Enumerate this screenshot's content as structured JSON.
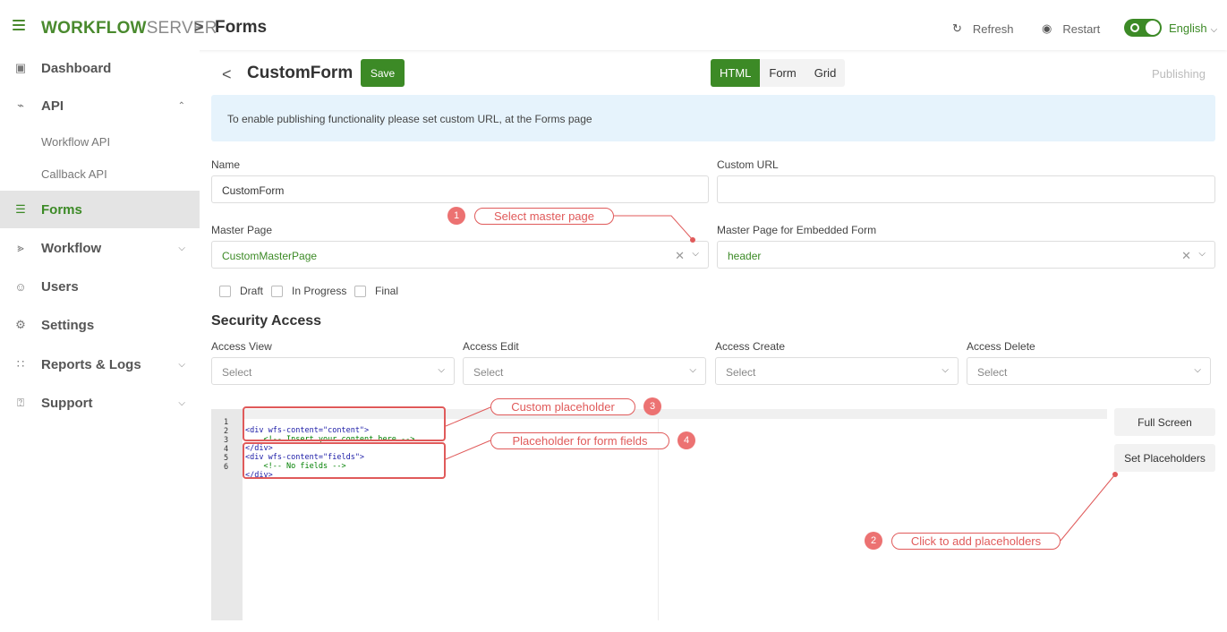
{
  "header": {
    "brand_bold": "WORKFLOW",
    "brand_light": "SERVER",
    "breadcrumb_sep": ">",
    "breadcrumb_current": "Forms",
    "refresh_label": "Refresh",
    "restart_label": "Restart",
    "language": "English"
  },
  "sidebar": {
    "items": [
      {
        "label": "Dashboard",
        "icon": "dashboard-icon"
      },
      {
        "label": "API",
        "icon": "plug-icon",
        "expanded": true
      },
      {
        "label": "Forms",
        "icon": "form-icon",
        "active": true
      },
      {
        "label": "Workflow",
        "icon": "workflow-icon"
      },
      {
        "label": "Users",
        "icon": "users-icon"
      },
      {
        "label": "Settings",
        "icon": "gears-icon"
      },
      {
        "label": "Reports & Logs",
        "icon": "reports-icon"
      },
      {
        "label": "Support",
        "icon": "question-icon"
      }
    ],
    "api_subitems": [
      "Workflow API",
      "Callback API"
    ]
  },
  "main": {
    "back_glyph": "<",
    "form_title": "CustomForm",
    "save_label": "Save",
    "tabs": [
      "HTML",
      "Form",
      "Grid"
    ],
    "active_tab": "HTML",
    "publishing_label": "Publishing",
    "info_message": "To enable publishing functionality please set custom URL, at the Forms page",
    "fields": {
      "name_label": "Name",
      "name_value": "CustomForm",
      "custom_url_label": "Custom URL",
      "custom_url_value": "",
      "master_page_label": "Master Page",
      "master_page_value": "CustomMasterPage",
      "embedded_master_label": "Master Page for Embedded Form",
      "embedded_master_value": "header"
    },
    "statuses": [
      "Draft",
      "In Progress",
      "Final"
    ],
    "security": {
      "title": "Security Access",
      "columns": [
        {
          "label": "Access View",
          "value": "Select"
        },
        {
          "label": "Access Edit",
          "value": "Select"
        },
        {
          "label": "Access Create",
          "value": "Select"
        },
        {
          "label": "Access Delete",
          "value": "Select"
        }
      ]
    },
    "editor": {
      "lines": [
        {
          "n": "1",
          "code": "<div wfs-content=\"content\">"
        },
        {
          "n": "2",
          "code": "    <!-- Insert your content here -->"
        },
        {
          "n": "3",
          "code": "</div>"
        },
        {
          "n": "4",
          "code": "<div wfs-content=\"fields\">"
        },
        {
          "n": "5",
          "code": "    <!-- No fields -->"
        },
        {
          "n": "6",
          "code": "</div>"
        }
      ]
    },
    "full_screen_label": "Full Screen",
    "set_placeholders_label": "Set Placeholders"
  },
  "annotations": [
    {
      "num": "1",
      "text": "Select master page"
    },
    {
      "num": "2",
      "text": "Click to add placeholders"
    },
    {
      "num": "3",
      "text": "Custom placeholder"
    },
    {
      "num": "4",
      "text": "Placeholder for form fields"
    }
  ],
  "colors": {
    "accent": "#3c8a26",
    "annotation": "#e05a5a",
    "info_bg": "#e6f3fc"
  }
}
